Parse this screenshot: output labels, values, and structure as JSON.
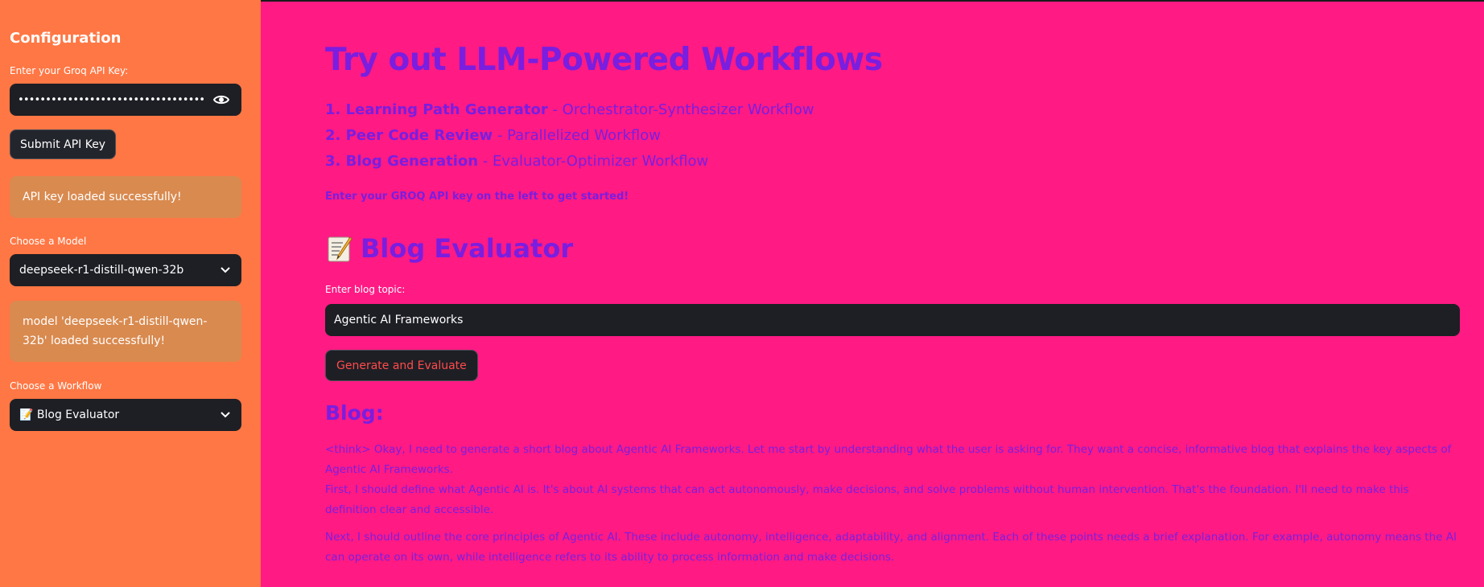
{
  "sidebar": {
    "title": "Configuration",
    "api_key_label": "Enter your Groq API Key:",
    "api_key_value": "••••••••••••••••••••••••••••••••••••••••••••••••••••••••",
    "submit_label": "Submit API Key",
    "api_success": "API key loaded successfully!",
    "model_label": "Choose a Model",
    "model_value": "deepseek-r1-distill-qwen-32b",
    "model_success": "model 'deepseek-r1-distill-qwen-32b' loaded successfully!",
    "workflow_label": "Choose a Workflow",
    "workflow_value": "Blog Evaluator",
    "workflow_emoji": "📝"
  },
  "main": {
    "title": "Try out LLM-Powered Workflows",
    "workflows": [
      {
        "num": "1.",
        "name": "Learning Path Generator",
        "desc": " - Orchestrator-Synthesizer Workflow"
      },
      {
        "num": "2.",
        "name": "Peer Code Review",
        "desc": " - Parallelized Workflow"
      },
      {
        "num": "3.",
        "name": "Blog Generation",
        "desc": " - Evaluator-Optimizer Workflow"
      }
    ],
    "hint": "Enter your GROQ API key on the left to get started!",
    "section_title": "Blog Evaluator",
    "topic_label": "Enter blog topic:",
    "topic_value": "Agentic AI Frameworks",
    "generate_label": "Generate and Evaluate",
    "blog_heading": "Blog:",
    "blog_paragraphs": [
      "<think> Okay, I need to generate a short blog about Agentic AI Frameworks. Let me start by understanding what the user is asking for. They want a concise, informative blog that explains the key aspects of Agentic AI Frameworks.",
      "First, I should define what Agentic AI is. It's about AI systems that can act autonomously, make decisions, and solve problems without human intervention. That's the foundation. I'll need to make this definition clear and accessible.",
      "Next, I should outline the core principles of Agentic AI. These include autonomy, intelligence, adaptability, and alignment. Each of these points needs a brief explanation. For example, autonomy means the AI can operate on its own, while intelligence refers to its ability to process information and make decisions."
    ]
  },
  "colors": {
    "sidebar_bg": "#ff7744",
    "main_bg": "#ff1a84",
    "accent_text": "#7a1ee0",
    "alert_bg": "#d98a4f",
    "input_bg": "#1e1f25",
    "generate_text": "#ff4b4b"
  }
}
